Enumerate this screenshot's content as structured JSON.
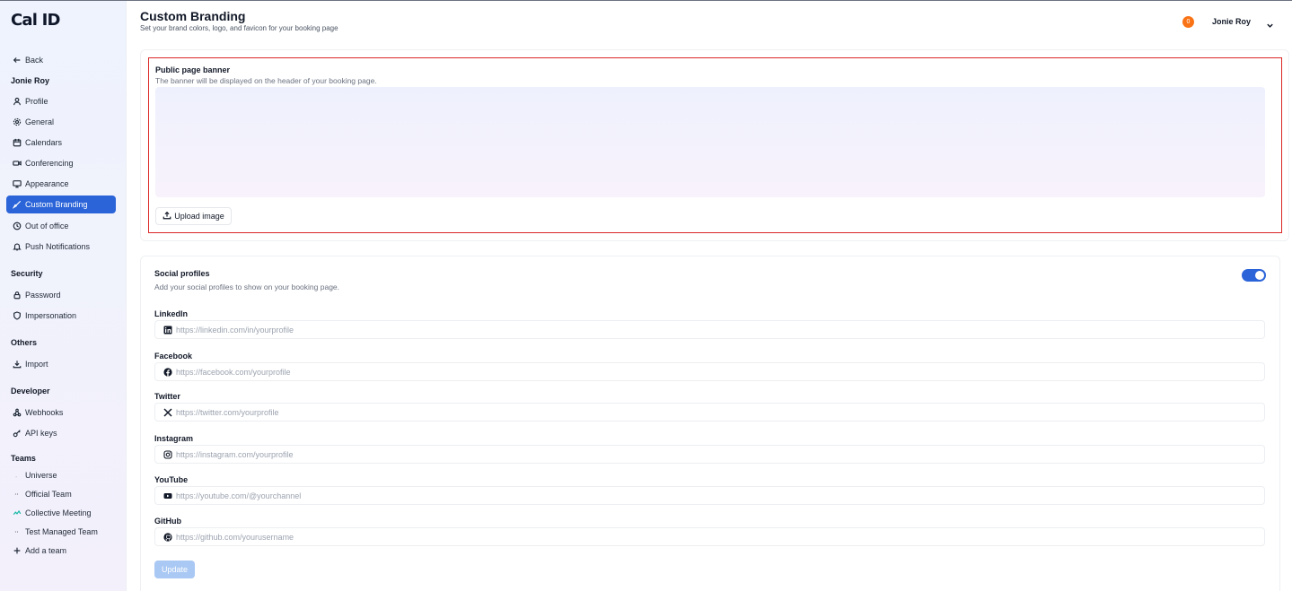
{
  "sidebar": {
    "logo": "Cal ID",
    "back": "Back",
    "user": "Jonie Roy",
    "items": [
      {
        "label": "Profile"
      },
      {
        "label": "General"
      },
      {
        "label": "Calendars"
      },
      {
        "label": "Conferencing"
      },
      {
        "label": "Appearance"
      },
      {
        "label": "Custom Branding"
      },
      {
        "label": "Out of office"
      },
      {
        "label": "Push Notifications"
      }
    ],
    "security": {
      "heading": "Security",
      "items": [
        "Password",
        "Impersonation"
      ]
    },
    "others": {
      "heading": "Others",
      "items": [
        "Import"
      ]
    },
    "developer": {
      "heading": "Developer",
      "items": [
        "Webhooks",
        "API keys"
      ]
    },
    "teams": {
      "heading": "Teams",
      "items": [
        "Universe",
        "Official Team",
        "Collective Meeting",
        "Test Managed Team",
        "Add a team"
      ]
    }
  },
  "header": {
    "title": "Custom Branding",
    "subtitle": "Set your brand colors, logo, and favicon for your booking page",
    "notif_count": "0",
    "user_name": "Jonie Roy"
  },
  "banner": {
    "label": "Public page banner",
    "description": "The banner will be displayed on the header of your booking page.",
    "upload_label": "Upload image"
  },
  "social": {
    "label": "Social profiles",
    "description": "Add your social profiles to show on your booking page.",
    "toggle_on": true,
    "fields": [
      {
        "label": "LinkedIn",
        "placeholder": "https://linkedin.com/in/yourprofile"
      },
      {
        "label": "Facebook",
        "placeholder": "https://facebook.com/yourprofile"
      },
      {
        "label": "Twitter",
        "placeholder": "https://twitter.com/yourprofile"
      },
      {
        "label": "Instagram",
        "placeholder": "https://instagram.com/yourprofile"
      },
      {
        "label": "YouTube",
        "placeholder": "https://youtube.com/@yourchannel"
      },
      {
        "label": "GitHub",
        "placeholder": "https://github.com/yourusername"
      }
    ],
    "update_label": "Update"
  },
  "colors": {
    "accent": "#2b64d8",
    "highlight_border": "#dc2626",
    "notif": "#f97316"
  }
}
